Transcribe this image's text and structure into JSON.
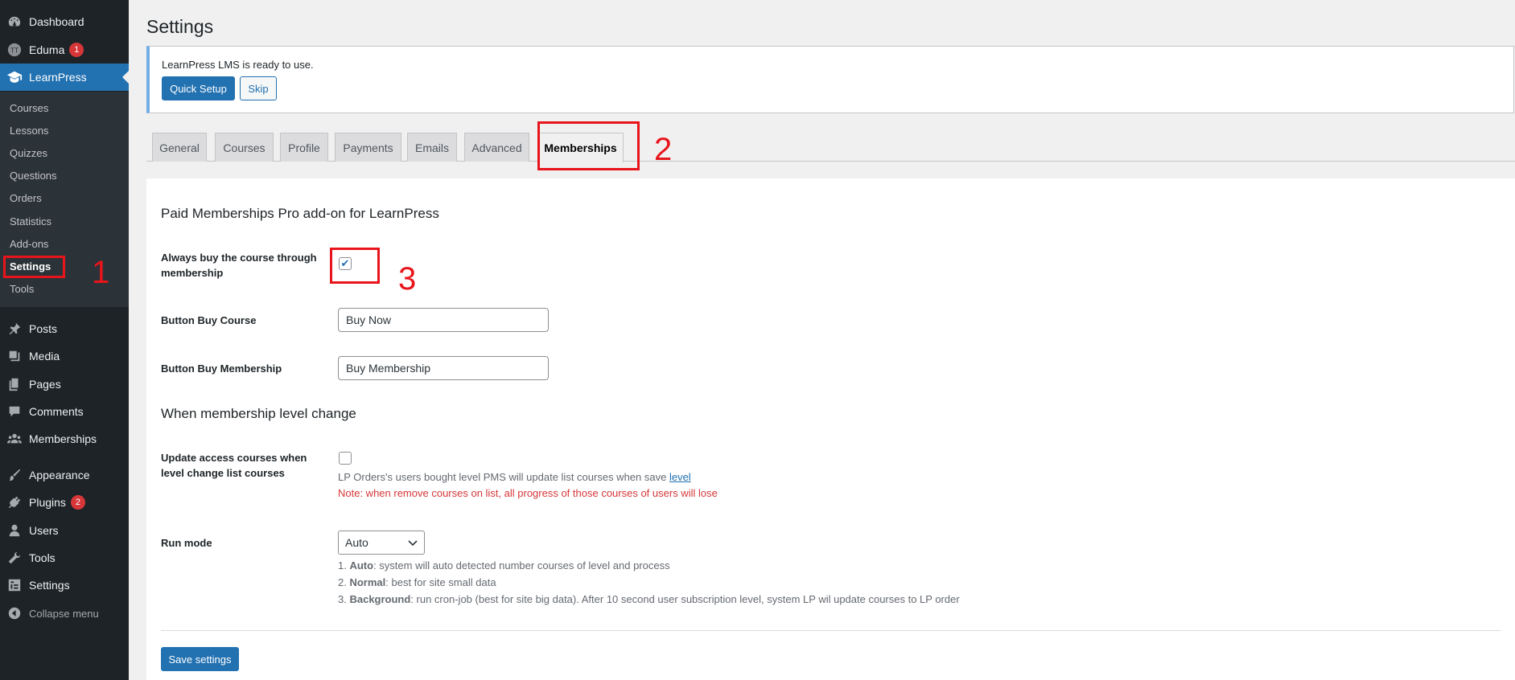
{
  "sidebar": {
    "menu": [
      {
        "label": "Dashboard",
        "icon": "dashboard-icon"
      },
      {
        "label": "Eduma",
        "icon": "eduma-icon",
        "badge": "1"
      },
      {
        "label": "LearnPress",
        "icon": "graduation-cap-icon"
      }
    ],
    "submenu": [
      "Courses",
      "Lessons",
      "Quizzes",
      "Questions",
      "Orders",
      "Statistics",
      "Add-ons",
      "Settings",
      "Tools"
    ],
    "menu2": [
      {
        "label": "Posts",
        "icon": "pin-icon"
      },
      {
        "label": "Media",
        "icon": "media-icon"
      },
      {
        "label": "Pages",
        "icon": "pages-icon"
      },
      {
        "label": "Comments",
        "icon": "comments-icon"
      },
      {
        "label": "Memberships",
        "icon": "groups-icon"
      },
      {
        "label": "Appearance",
        "icon": "brush-icon"
      },
      {
        "label": "Plugins",
        "icon": "plugin-icon",
        "badge": "2"
      },
      {
        "label": "Users",
        "icon": "users-icon"
      },
      {
        "label": "Tools",
        "icon": "wrench-icon"
      },
      {
        "label": "Settings",
        "icon": "settings-icon"
      }
    ],
    "collapse_label": "Collapse menu"
  },
  "page": {
    "title": "Settings",
    "notice": {
      "text": "LearnPress LMS is ready to use.",
      "quick_setup": "Quick Setup",
      "skip": "Skip"
    },
    "tabs": [
      "General",
      "Courses",
      "Profile",
      "Payments",
      "Emails",
      "Advanced",
      "Memberships"
    ],
    "active_tab": "Memberships"
  },
  "form": {
    "section1_title": "Paid Memberships Pro add-on for LearnPress",
    "always_buy_label": "Always buy the course through membership",
    "always_buy_checked": true,
    "button_buy_course_label": "Button Buy Course",
    "button_buy_course_value": "Buy Now",
    "button_buy_membership_label": "Button Buy Membership",
    "button_buy_membership_value": "Buy Membership",
    "section2_title": "When membership level change",
    "update_access_label": "Update access courses when level change list courses",
    "update_access_checked": false,
    "update_access_desc": "LP Orders's users bought level PMS will update list courses when save",
    "update_access_link": "level",
    "update_access_note": "Note: when remove courses on list, all progress of those courses of users will lose",
    "run_mode_label": "Run mode",
    "run_mode_value": "Auto",
    "run_mode_desc": [
      {
        "num": "1.",
        "bold": "Auto",
        "text": ": system will auto detected number courses of level and process"
      },
      {
        "num": "2.",
        "bold": "Normal",
        "text": ": best for site small data"
      },
      {
        "num": "3.",
        "bold": "Background",
        "text": ": run cron-job (best for site big data). After 10 second user subscription level, system LP wil update courses to LP order"
      }
    ],
    "save_label": "Save settings"
  },
  "annotations": [
    "1",
    "2",
    "3"
  ],
  "colors": {
    "sidebar_bg": "#1d2327",
    "accent": "#2271b1",
    "annotation": "#e8141b",
    "badge": "#d63638"
  }
}
